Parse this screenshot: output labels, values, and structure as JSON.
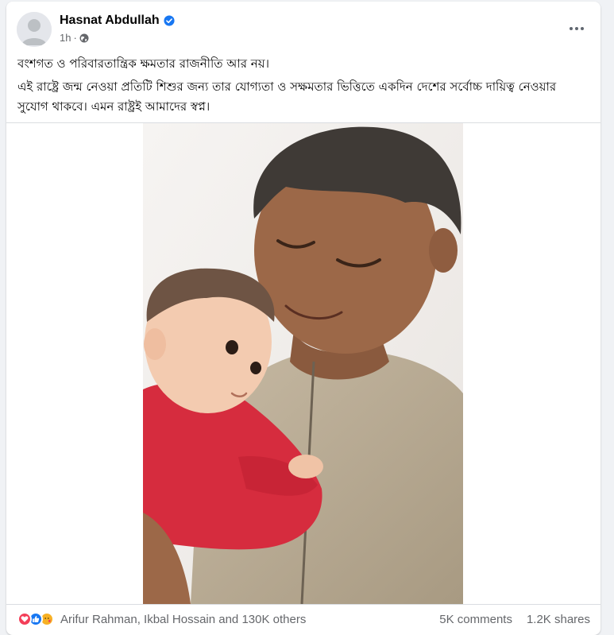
{
  "post": {
    "author": "Hasnat Abdullah",
    "time": "1h",
    "separator": "·",
    "audience_icon": "globe-icon",
    "verified_icon": "verified-badge-icon",
    "more_icon": "more-options-icon",
    "paragraphs": [
      "বংশগত ও পরিবারতান্ত্রিক ক্ষমতার রাজনীতি আর নয়।",
      "এই রাষ্ট্রে জন্ম নেওয়া প্রতিটি শিশুর জন্য তার যোগ্যতা ও সক্ষমতার ভিত্তিতে একদিন দেশের সর্বোচ্চ দায়িত্ব নেওয়ার সুযোগ থাকবে। এমন রাষ্ট্রই আমাদের স্বপ্ন।"
    ]
  },
  "footer": {
    "reaction_icons": [
      "love-icon",
      "like-icon",
      "care-icon"
    ],
    "reaction_summary": "Arifur Rahman, Ikbal Hossain and 130K others",
    "comments": "5K comments",
    "shares": "1.2K shares"
  },
  "colors": {
    "verified": "#1877f2",
    "like": "#1877f2",
    "love": "#f33e58",
    "care": "#f7b125",
    "secondary_text": "#65676b"
  }
}
